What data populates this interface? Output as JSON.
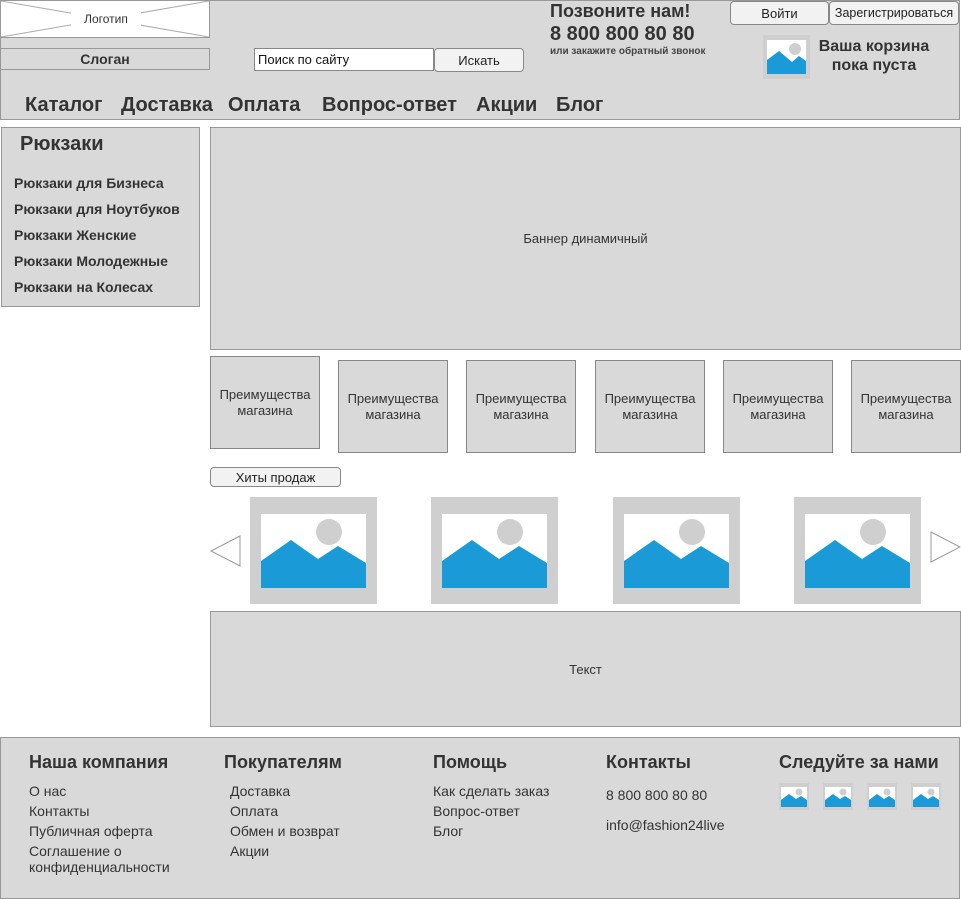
{
  "header": {
    "logo_text": "Логотип",
    "slogan": "Слоган",
    "search": {
      "value": "Поиск по сайту",
      "button": "Искать"
    },
    "call": {
      "title": "Позвоните нам!",
      "phone": "8 800 800 80 80",
      "callback": "или закажите обратный звонок"
    },
    "auth": {
      "login": "Войти",
      "register": "Зарегистрироваться"
    },
    "cart": {
      "line1": "Ваша корзина",
      "line2": "пока пуста",
      "icon": "image-icon"
    }
  },
  "nav": [
    "Каталог",
    "Доставка",
    "Оплата",
    "Вопрос-ответ",
    "Акции",
    "Блог"
  ],
  "sidebar": {
    "title": "Рюкзаки",
    "items": [
      "Рюкзаки для Бизнеса",
      "Рюкзаки для Ноутбуков",
      "Рюкзаки Женские",
      "Рюкзаки Молодежные",
      "Рюкзаки на Колесах"
    ]
  },
  "banner": "Баннер динамичный",
  "features": [
    {
      "line1": "Преимущества",
      "line2": "магазина"
    },
    {
      "line1": "Преимущества",
      "line2": "магазина"
    },
    {
      "line1": "Преимущества",
      "line2": "магазина"
    },
    {
      "line1": "Преимущества",
      "line2": "магазина"
    },
    {
      "line1": "Преимущества",
      "line2": "магазина"
    },
    {
      "line1": "Преимущества",
      "line2": "магазина"
    }
  ],
  "hits_label": "Хиты продаж",
  "carousel": {
    "prev_icon": "arrow-left-icon",
    "next_icon": "arrow-right-icon",
    "items": [
      "image-icon",
      "image-icon",
      "image-icon",
      "image-icon"
    ]
  },
  "text_block": "Текст",
  "footer": {
    "company": {
      "title": "Наша компания",
      "links": [
        "О нас",
        "Контакты",
        "Публичная оферта",
        "Соглашение о конфиденциальности"
      ]
    },
    "buyers": {
      "title": "Покупателям",
      "links": [
        "Доставка",
        "Оплата",
        "Обмен и возврат",
        "Акции"
      ]
    },
    "help": {
      "title": "Помощь",
      "links": [
        "Как сделать заказ",
        "Вопрос-ответ",
        "Блог"
      ]
    },
    "contacts": {
      "title": "Контакты",
      "phone": "8 800 800 80 80",
      "email": "info@fashion24live"
    },
    "social": {
      "title": "Следуйте за нами",
      "icons": [
        "image-icon",
        "image-icon",
        "image-icon",
        "image-icon"
      ]
    }
  },
  "colors": {
    "panel": "#d9d9d9",
    "image_blue": "#1a9ad6",
    "image_bg": "#cfcfcf"
  }
}
